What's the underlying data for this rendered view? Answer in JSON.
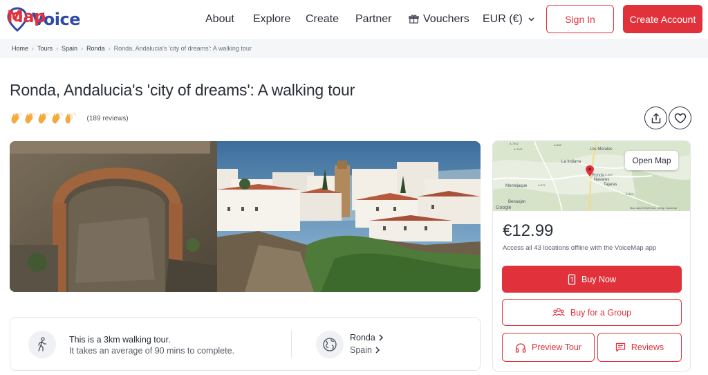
{
  "header": {
    "logo_voice": "Voice",
    "logo_map": "Map",
    "nav": [
      "About",
      "Explore",
      "Create",
      "Partner"
    ],
    "vouchers": "Vouchers",
    "currency": "EUR (€)",
    "sign_in": "Sign In",
    "create_account": "Create Account"
  },
  "breadcrumb": {
    "items": [
      "Home",
      "Tours",
      "Spain",
      "Ronda"
    ],
    "current": "Ronda, Andalucia's 'city of dreams': A walking tour"
  },
  "tour": {
    "title": "Ronda, Andalucia's 'city of dreams': A walking tour",
    "rating": 4.5,
    "rating_max": 5,
    "reviews_count": "(189 reviews)"
  },
  "info": {
    "distance_line": "This is a 3km walking tour.",
    "duration_line": "It takes an average of 90 mins to complete.",
    "city": "Ronda",
    "country": "Spain"
  },
  "map": {
    "open_map": "Open Map",
    "labels": [
      "Los Morales",
      "La Indiana",
      "Montejaque",
      "Benaojan",
      "Ronda",
      "Navares",
      "Tajaras",
      "Google",
      "Map data ©2026 Inst. Geogr. Nacional",
      "A-7402",
      "A-366",
      "A-369",
      "A-374",
      "A-397",
      "A-7401"
    ]
  },
  "booking": {
    "price": "€12.99",
    "note": "Access all 43 locations offline with the VoiceMap app",
    "buy_now": "Buy Now",
    "buy_group": "Buy for a Group",
    "preview": "Preview Tour",
    "reviews": "Reviews"
  },
  "colors": {
    "brand_red": "#e1323c",
    "brand_blue": "#2f4aa8",
    "text": "#2b2f3a",
    "clap_gold": "#f3a93c"
  },
  "icons": [
    "logo-pin-icon",
    "gift-icon",
    "chevron-down-icon",
    "clap-icon",
    "share-icon",
    "heart-icon",
    "walking-person-icon",
    "globe-icon",
    "chevron-right-icon",
    "phone-icon",
    "group-icon",
    "headphones-icon",
    "reviews-icon",
    "map-pin-icon"
  ]
}
